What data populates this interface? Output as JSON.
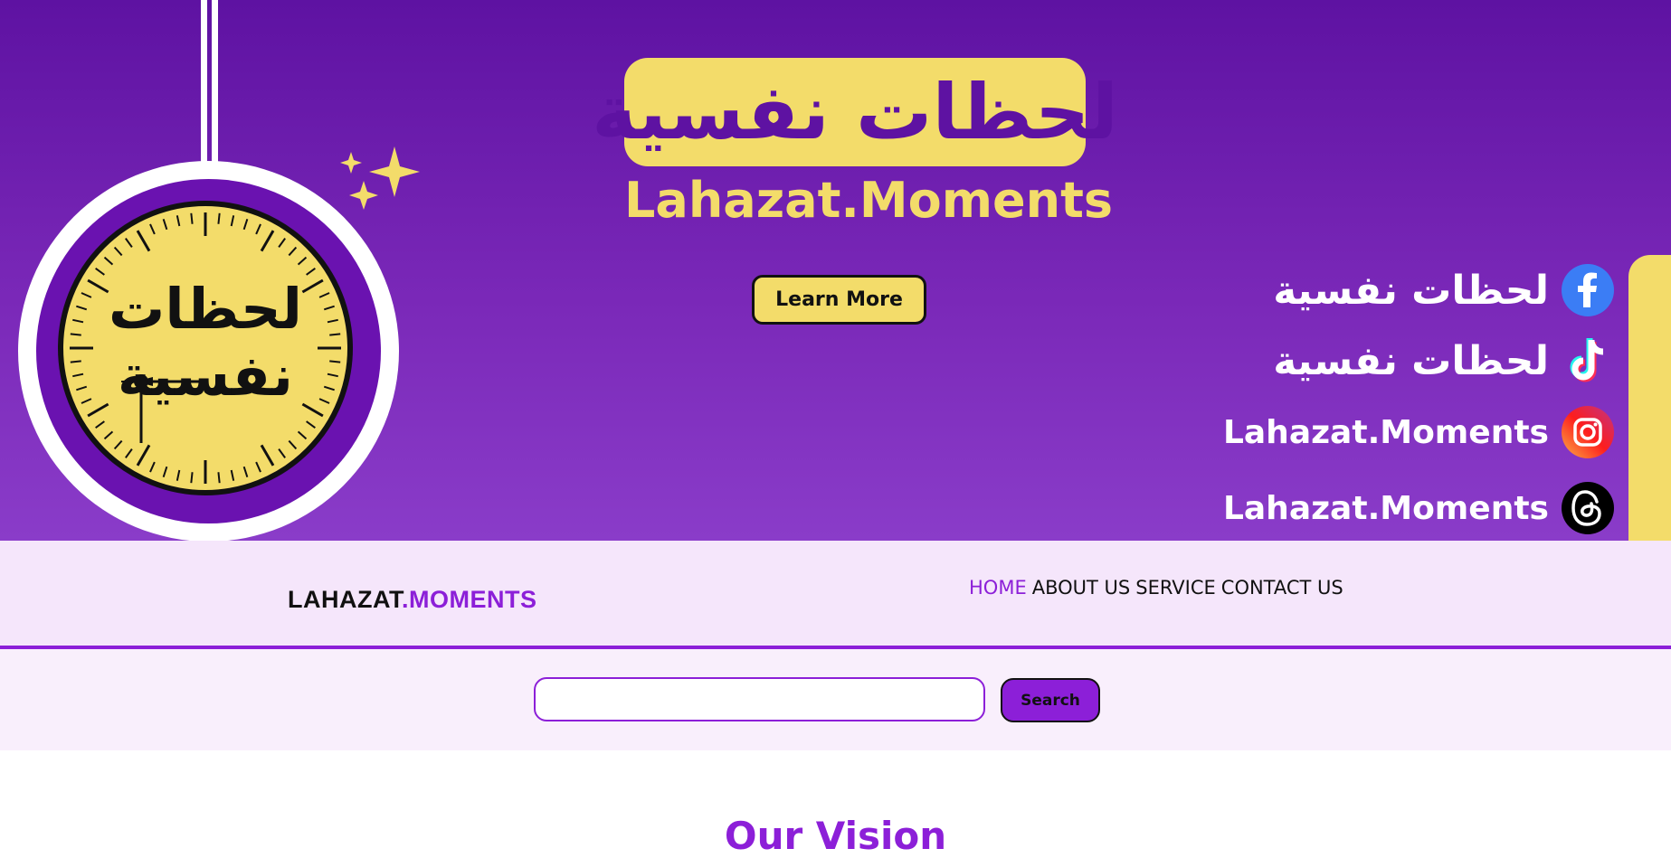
{
  "hero": {
    "title_ar": "لحظات نفسية",
    "subtitle": "Lahazat.Moments",
    "clock_text_line1": "لحظات",
    "clock_text_line2": "نفسية",
    "learn_more_label": "Learn More",
    "social": [
      {
        "icon": "facebook-icon",
        "label": "لحظات نفسية"
      },
      {
        "icon": "tiktok-icon",
        "label": "لحظات نفسية"
      },
      {
        "icon": "instagram-icon",
        "label": "Lahazat.Moments"
      },
      {
        "icon": "threads-icon",
        "label": "Lahazat.Moments"
      }
    ]
  },
  "navbar": {
    "logo_part1": "LAHAZAT",
    "logo_part2": ".MOMENTS",
    "links": [
      "HOME",
      "ABOUT US",
      "SERVICE",
      "CONTACT US"
    ],
    "active": "HOME"
  },
  "search": {
    "placeholder": "",
    "button_label": "Search"
  },
  "main": {
    "section_title": "Our Vision"
  },
  "colors": {
    "primary_purple": "#8c1fd8",
    "hero_purple": "#5e12a2",
    "accent_yellow": "#f3dc6a"
  }
}
